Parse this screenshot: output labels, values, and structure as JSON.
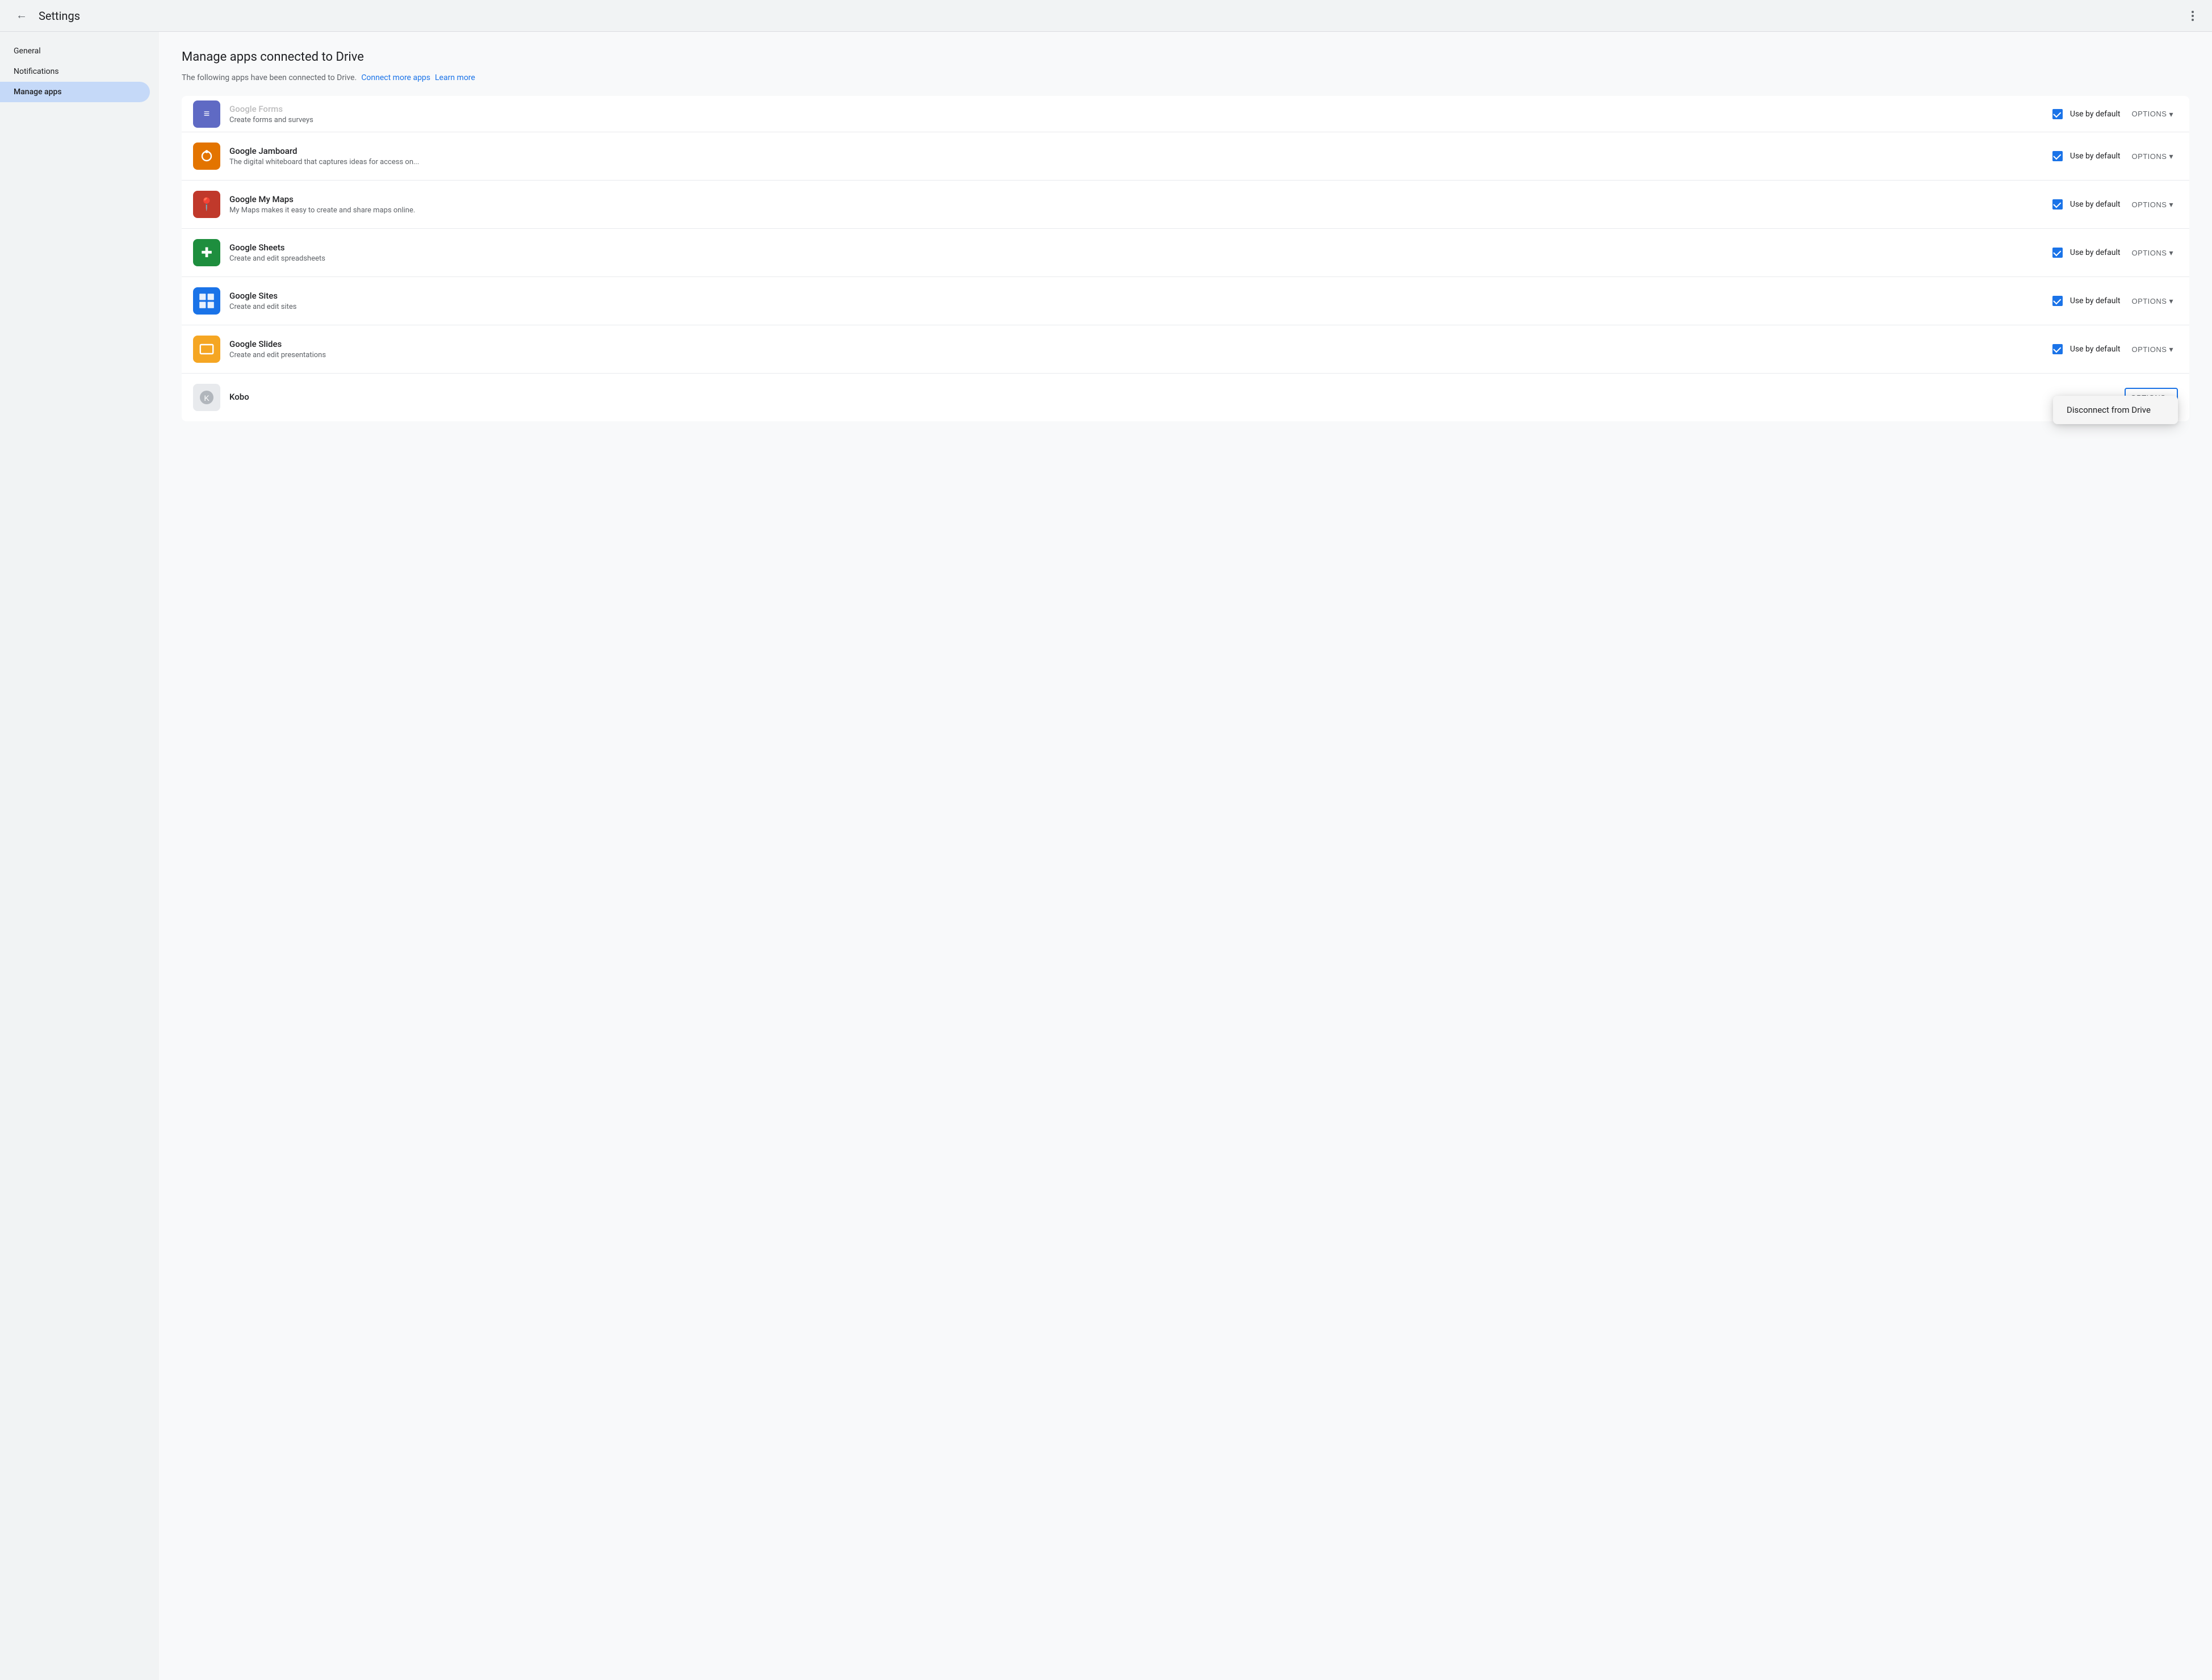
{
  "topbar": {
    "title": "Settings",
    "back_label": "←",
    "dots_label": "⋮"
  },
  "sidebar": {
    "items": [
      {
        "id": "general",
        "label": "General",
        "active": false
      },
      {
        "id": "notifications",
        "label": "Notifications",
        "active": false
      },
      {
        "id": "manage-apps",
        "label": "Manage apps",
        "active": true
      }
    ]
  },
  "content": {
    "title": "Manage apps connected to Drive",
    "subtitle": "The following apps have been connected to Drive.",
    "connect_link": "Connect more apps",
    "learn_link": "Learn more",
    "apps": [
      {
        "id": "google-forms",
        "name": "Google Forms",
        "desc": "Create forms and surveys",
        "icon_color": "#4A4AFF",
        "icon_char": "≡",
        "use_by_default": true,
        "checked": true,
        "partial": true
      },
      {
        "id": "google-jamboard",
        "name": "Google Jamboard",
        "desc": "The digital whiteboard that captures ideas for access on...",
        "icon_color": "#E37400",
        "icon_char": "J",
        "use_by_default": true,
        "checked": true,
        "partial": false
      },
      {
        "id": "google-my-maps",
        "name": "Google My Maps",
        "desc": "My Maps makes it easy to create and share maps online.",
        "icon_color": "#C0392B",
        "icon_char": "📍",
        "use_by_default": true,
        "checked": true,
        "partial": false
      },
      {
        "id": "google-sheets",
        "name": "Google Sheets",
        "desc": "Create and edit spreadsheets",
        "icon_color": "#1E8E3E",
        "icon_char": "+",
        "use_by_default": true,
        "checked": true,
        "partial": false
      },
      {
        "id": "google-sites",
        "name": "Google Sites",
        "desc": "Create and edit sites",
        "icon_color": "#1A73E8",
        "icon_char": "⊞",
        "use_by_default": true,
        "checked": true,
        "partial": false
      },
      {
        "id": "google-slides",
        "name": "Google Slides",
        "desc": "Create and edit presentations",
        "icon_color": "#F5A623",
        "icon_char": "▭",
        "use_by_default": true,
        "checked": true,
        "partial": false,
        "show_dropdown": true
      },
      {
        "id": "kobo",
        "name": "Kobo",
        "desc": "",
        "icon_type": "kobo",
        "use_by_default": false,
        "checked": false,
        "partial": false,
        "options_active": true
      }
    ],
    "options_label": "OPTIONS",
    "use_by_default_label": "Use by default",
    "dropdown": {
      "items": [
        {
          "id": "disconnect",
          "label": "Disconnect from Drive"
        }
      ]
    }
  }
}
